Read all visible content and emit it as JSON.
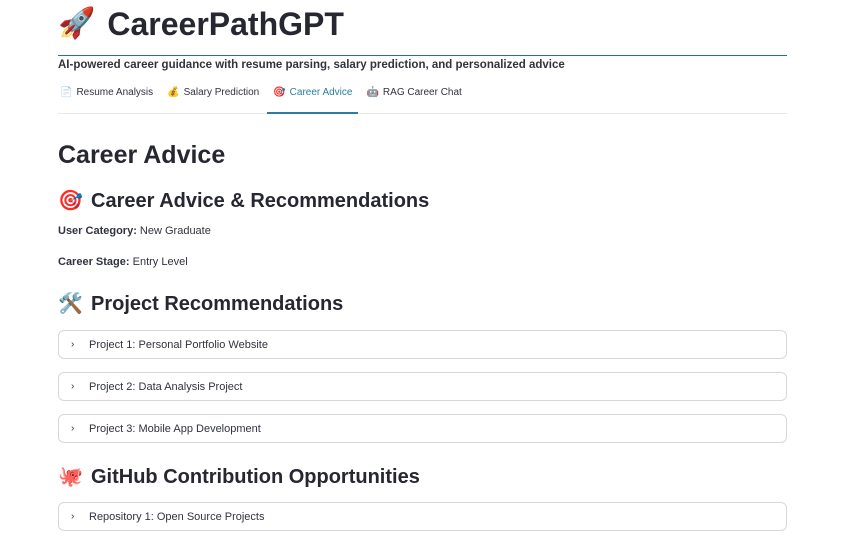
{
  "app": {
    "title": "CareerPathGPT",
    "title_icon": "rocket-icon",
    "subtitle": "AI-powered career guidance with resume parsing, salary prediction, and personalized advice"
  },
  "tabs": [
    {
      "icon": "page-icon",
      "label": "Resume Analysis",
      "active": false
    },
    {
      "icon": "money-bag-icon",
      "label": "Salary Prediction",
      "active": false
    },
    {
      "icon": "target-icon",
      "label": "Career Advice",
      "active": true
    },
    {
      "icon": "robot-icon",
      "label": "RAG Career Chat",
      "active": false
    }
  ],
  "page": {
    "heading": "Career Advice",
    "advice_section": {
      "icon": "target-icon",
      "title": "Career Advice & Recommendations",
      "user_category_label": "User Category:",
      "user_category_value": "New Graduate",
      "career_stage_label": "Career Stage:",
      "career_stage_value": "Entry Level"
    },
    "projects_section": {
      "icon": "tools-icon",
      "title": "Project Recommendations",
      "items": [
        "Project 1: Personal Portfolio Website",
        "Project 2: Data Analysis Project",
        "Project 3: Mobile App Development"
      ]
    },
    "github_section": {
      "icon": "octopus-icon",
      "title": "GitHub Contribution Opportunities",
      "items": [
        "Repository 1: Open Source Projects"
      ]
    }
  },
  "colors": {
    "accent": "#2a7ea2",
    "text": "#31333f",
    "border": "#d6d8de"
  }
}
